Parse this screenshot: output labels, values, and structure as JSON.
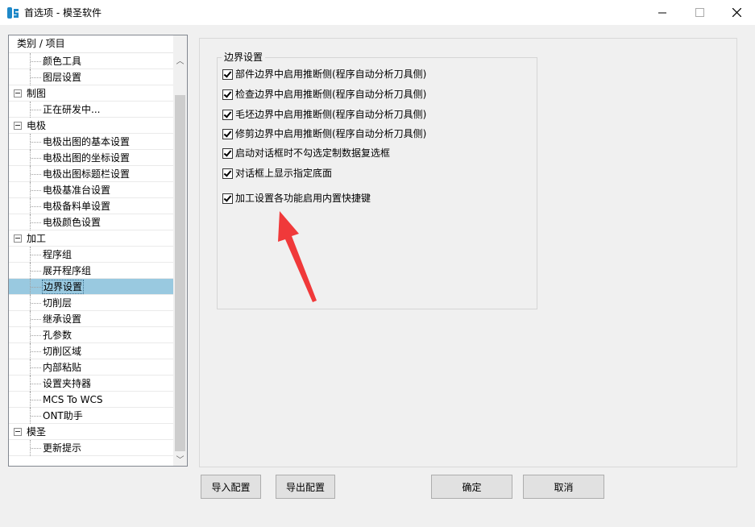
{
  "window": {
    "title": "首选项 - 模圣软件",
    "icon": "app-logo-icon",
    "controls": {
      "minimize": "minimize-icon",
      "maximize": "maximize-icon",
      "close": "close-icon"
    }
  },
  "tree": {
    "header": "类别 / 项目",
    "rows": [
      {
        "label": "颜色工具",
        "type": "child"
      },
      {
        "label": "图层设置",
        "type": "child"
      },
      {
        "label": "制图",
        "type": "parent"
      },
      {
        "label": "正在研发中...",
        "type": "child"
      },
      {
        "label": "电极",
        "type": "parent"
      },
      {
        "label": "电极出图的基本设置",
        "type": "child"
      },
      {
        "label": "电极出图的坐标设置",
        "type": "child"
      },
      {
        "label": "电极出图标题栏设置",
        "type": "child"
      },
      {
        "label": "电极基准台设置",
        "type": "child"
      },
      {
        "label": "电极备料单设置",
        "type": "child"
      },
      {
        "label": "电极颜色设置",
        "type": "child"
      },
      {
        "label": "加工",
        "type": "parent"
      },
      {
        "label": "程序组",
        "type": "child"
      },
      {
        "label": "展开程序组",
        "type": "child"
      },
      {
        "label": "边界设置",
        "type": "child",
        "selected": true
      },
      {
        "label": "切削层",
        "type": "child"
      },
      {
        "label": "继承设置",
        "type": "child"
      },
      {
        "label": "孔参数",
        "type": "child"
      },
      {
        "label": "切削区域",
        "type": "child"
      },
      {
        "label": "内部粘贴",
        "type": "child"
      },
      {
        "label": "设置夹持器",
        "type": "child"
      },
      {
        "label": "MCS To WCS",
        "type": "child"
      },
      {
        "label": "ONT助手",
        "type": "child"
      },
      {
        "label": "模圣",
        "type": "parent"
      },
      {
        "label": "更新提示",
        "type": "child"
      }
    ]
  },
  "group": {
    "title": "边界设置",
    "checkboxes": [
      {
        "label": "部件边界中启用推断侧(程序自动分析刀具侧)",
        "checked": true
      },
      {
        "label": "检查边界中启用推断侧(程序自动分析刀具侧)",
        "checked": true
      },
      {
        "label": "毛坯边界中启用推断侧(程序自动分析刀具侧)",
        "checked": true
      },
      {
        "label": "修剪边界中启用推断侧(程序自动分析刀具侧)",
        "checked": true
      },
      {
        "label": "启动对话框时不勾选定制数据复选框",
        "checked": true
      },
      {
        "label": "对话框上显示指定底面",
        "checked": true
      },
      {
        "label": "加工设置各功能启用内置快捷键",
        "checked": true
      }
    ]
  },
  "buttons": {
    "import": "导入配置",
    "export": "导出配置",
    "ok": "确定",
    "cancel": "取消"
  },
  "colors": {
    "selection": "#99c9e0",
    "annotation_arrow": "#f0393a"
  }
}
